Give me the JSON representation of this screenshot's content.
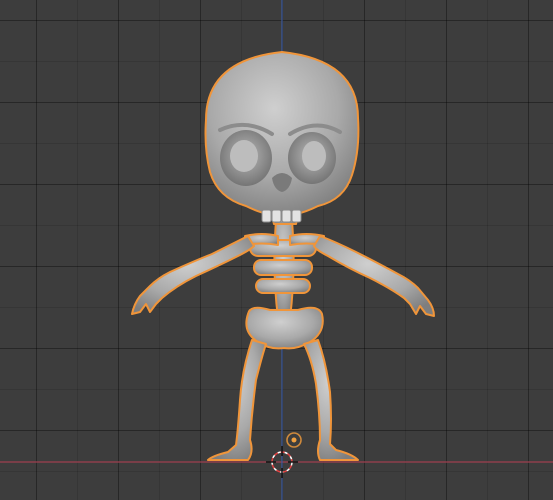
{
  "viewport": {
    "kind": "3d-viewport",
    "background_color": "#3d3d3d",
    "grid_color": "#2c2c2c",
    "axis_x_color": "#a04050",
    "axis_z_color": "#3c5a9e",
    "selection_outline_color": "#f0953a"
  },
  "scene": {
    "object": {
      "icon": "skeleton-character-model",
      "selected": true
    },
    "cursor": {
      "icon": "3d-cursor-icon"
    },
    "origin": {
      "icon": "object-origin-icon"
    }
  }
}
